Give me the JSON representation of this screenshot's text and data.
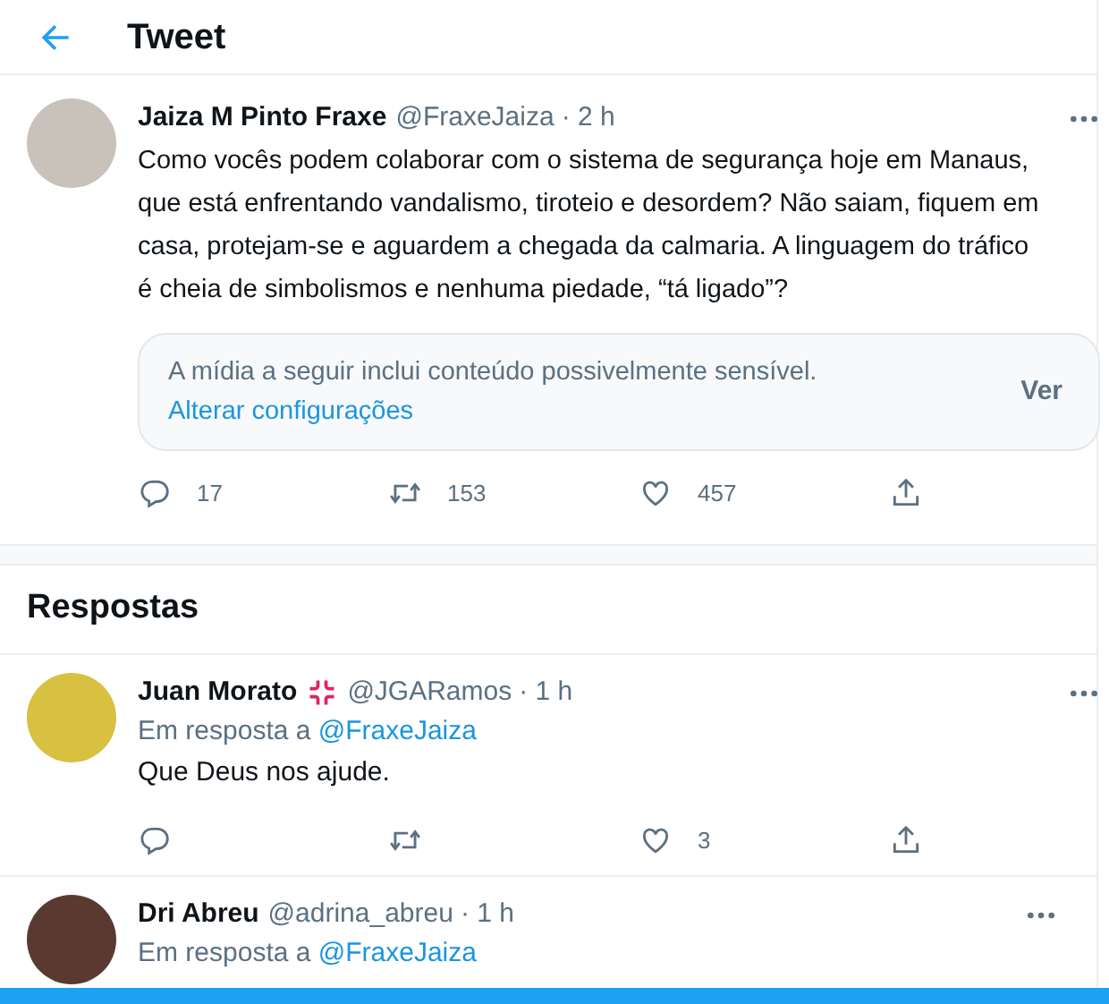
{
  "header": {
    "title": "Tweet"
  },
  "tweet": {
    "name": "Jaiza M Pinto Fraxe",
    "handle": "@FraxeJaiza",
    "time": "· 2 h",
    "text": "Como vocês podem colaborar com o sistema de segurança hoje em Manaus, que está enfrentando vandalismo, tiroteio e desordem? Não saiam, fiquem em casa, protejam-se e aguardem a chegada da calmaria. A linguagem do tráfico é cheia de simbolismos e nenhuma piedade, “tá ligado”?",
    "sensitive_notice": {
      "text": "A mídia a seguir inclui conteúdo possivelmente sensível.",
      "link": "Alterar configurações",
      "button": "Ver"
    },
    "actions": [
      {
        "kind": "reply",
        "count": "17"
      },
      {
        "kind": "retweet",
        "count": "153"
      },
      {
        "kind": "like",
        "count": "457"
      },
      {
        "kind": "share"
      }
    ]
  },
  "replies_heading": "Respostas",
  "replies": [
    {
      "name": "Juan Morato",
      "badge": true,
      "handle": "@JGARamos",
      "time": "· 1 h",
      "reply_to_label": "Em resposta a",
      "reply_to_handle": "@FraxeJaiza",
      "text": "Que Deus nos ajude.",
      "actions": [
        {
          "kind": "reply"
        },
        {
          "kind": "retweet"
        },
        {
          "kind": "like",
          "count": "3"
        },
        {
          "kind": "share"
        }
      ]
    },
    {
      "name": "Dri Abreu",
      "badge": false,
      "handle": "@adrina_abreu",
      "time": "· 1 h",
      "reply_to_label": "Em resposta a",
      "reply_to_handle": "@FraxeJaiza"
    }
  ]
}
